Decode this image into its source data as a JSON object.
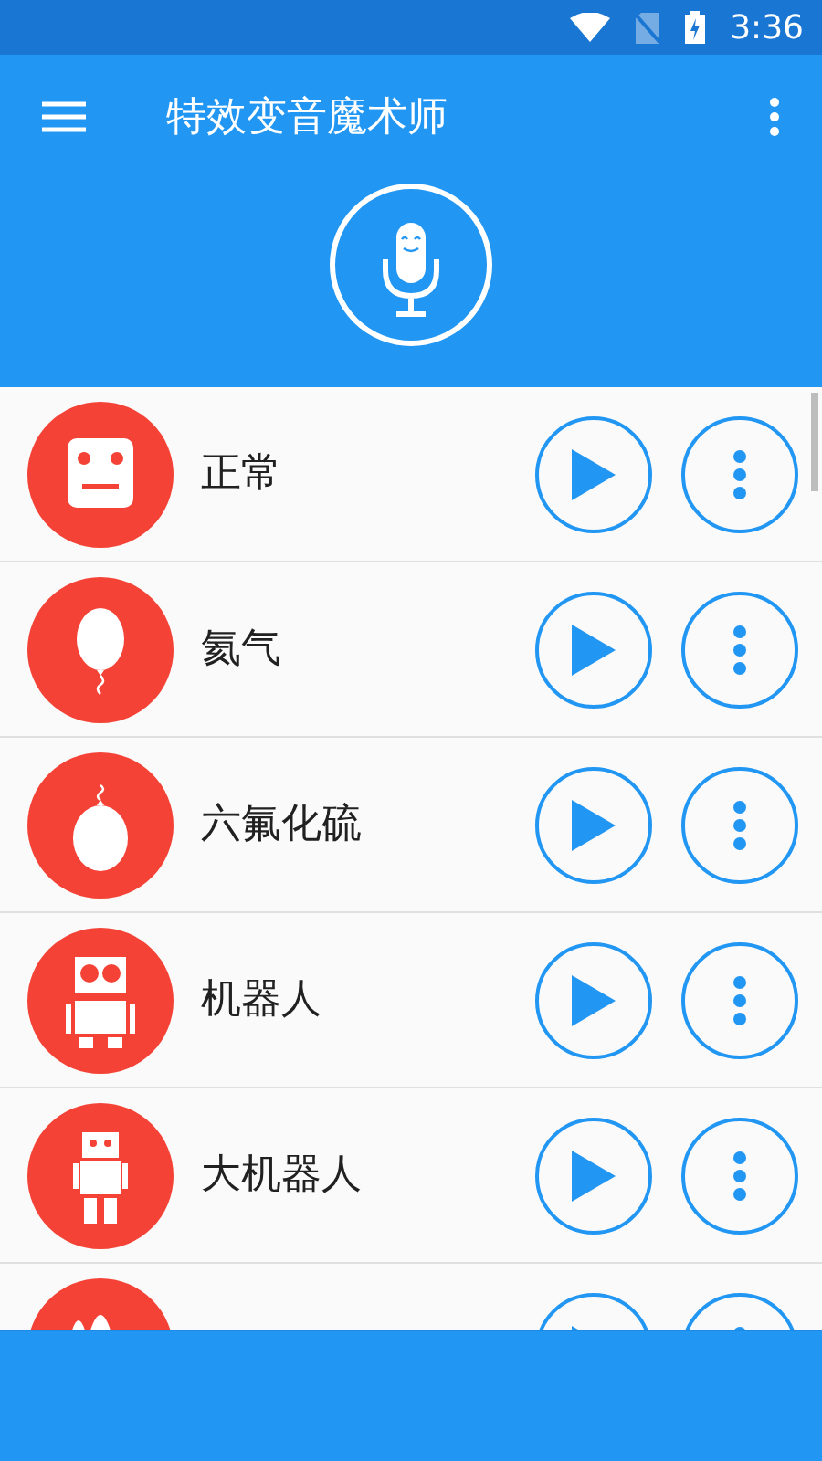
{
  "status_bar": {
    "time": "3:36"
  },
  "app_bar": {
    "title": "特效变音魔术师"
  },
  "effects": [
    {
      "kind": "face",
      "label": "正常"
    },
    {
      "kind": "balloon",
      "label": "氦气"
    },
    {
      "kind": "heavy",
      "label": "六氟化硫"
    },
    {
      "kind": "robot",
      "label": "机器人"
    },
    {
      "kind": "giant",
      "label": "大机器人"
    },
    {
      "kind": "spikes"
    }
  ]
}
